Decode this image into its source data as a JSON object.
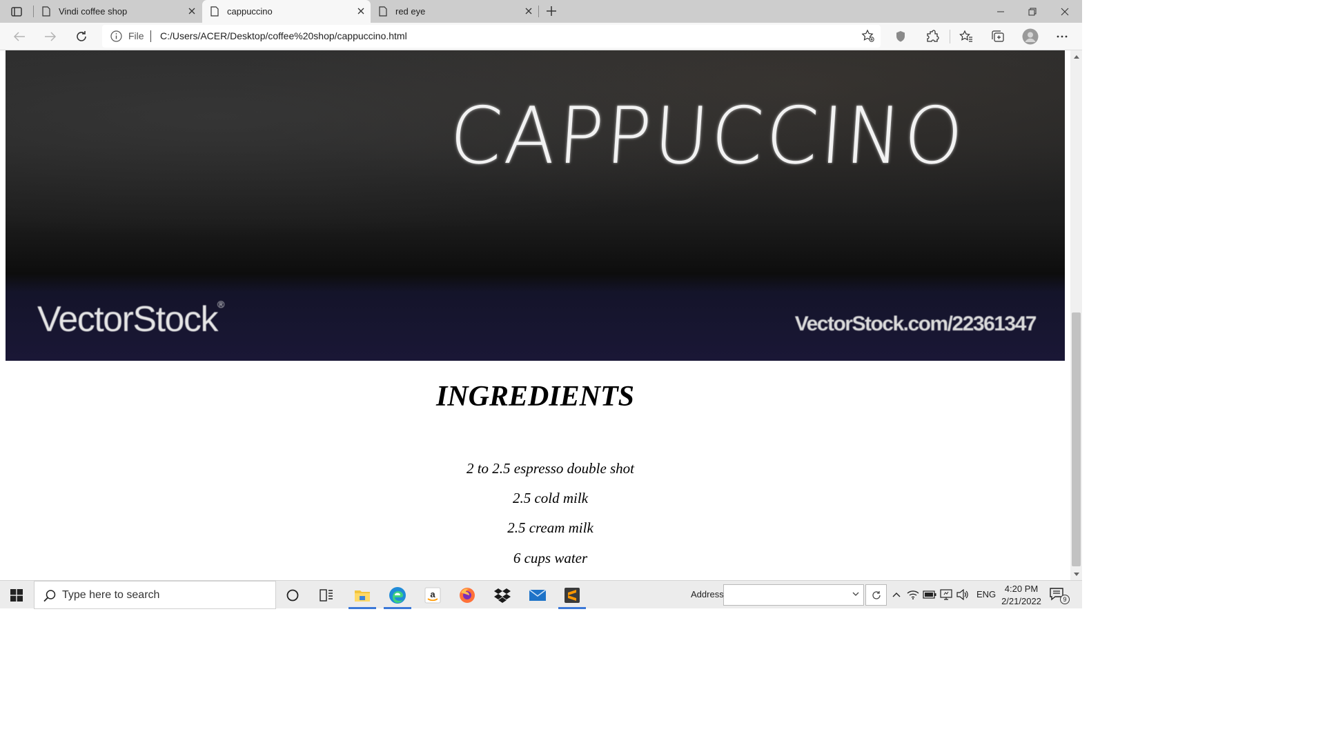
{
  "browser": {
    "tabs": [
      {
        "title": "Vindi coffee shop",
        "active": false
      },
      {
        "title": "cappuccino",
        "active": true
      },
      {
        "title": "red eye",
        "active": false
      }
    ],
    "address": {
      "scheme_label": "File",
      "url": "C:/Users/ACER/Desktop/coffee%20shop/cappuccino.html"
    }
  },
  "page": {
    "hero": {
      "title": "CAPPUCCINO",
      "watermark_logo": "VectorStock",
      "watermark_url": "VectorStock.com/22361347"
    },
    "ingredients_heading": "INGREDIENTS",
    "ingredients": [
      "2 to 2.5 espresso double shot",
      "2.5 cold milk",
      "2.5 cream milk",
      "6 cups water"
    ]
  },
  "taskbar": {
    "search_placeholder": "Type here to search",
    "address_label": "Address",
    "language": "ENG",
    "time": "4:20 PM",
    "date": "2/21/2022",
    "notification_count": "9",
    "pinned": [
      "cortana-icon",
      "task-view-icon",
      "file-explorer-icon",
      "edge-icon",
      "amazon-icon",
      "firefox-icon",
      "dropbox-icon",
      "mail-icon",
      "sublime-text-icon"
    ]
  },
  "colors": {
    "accent": "#3b78d8",
    "tabstrip": "#cdcdcd",
    "toolbar": "#f7f7f7",
    "taskbar": "#ececec"
  }
}
